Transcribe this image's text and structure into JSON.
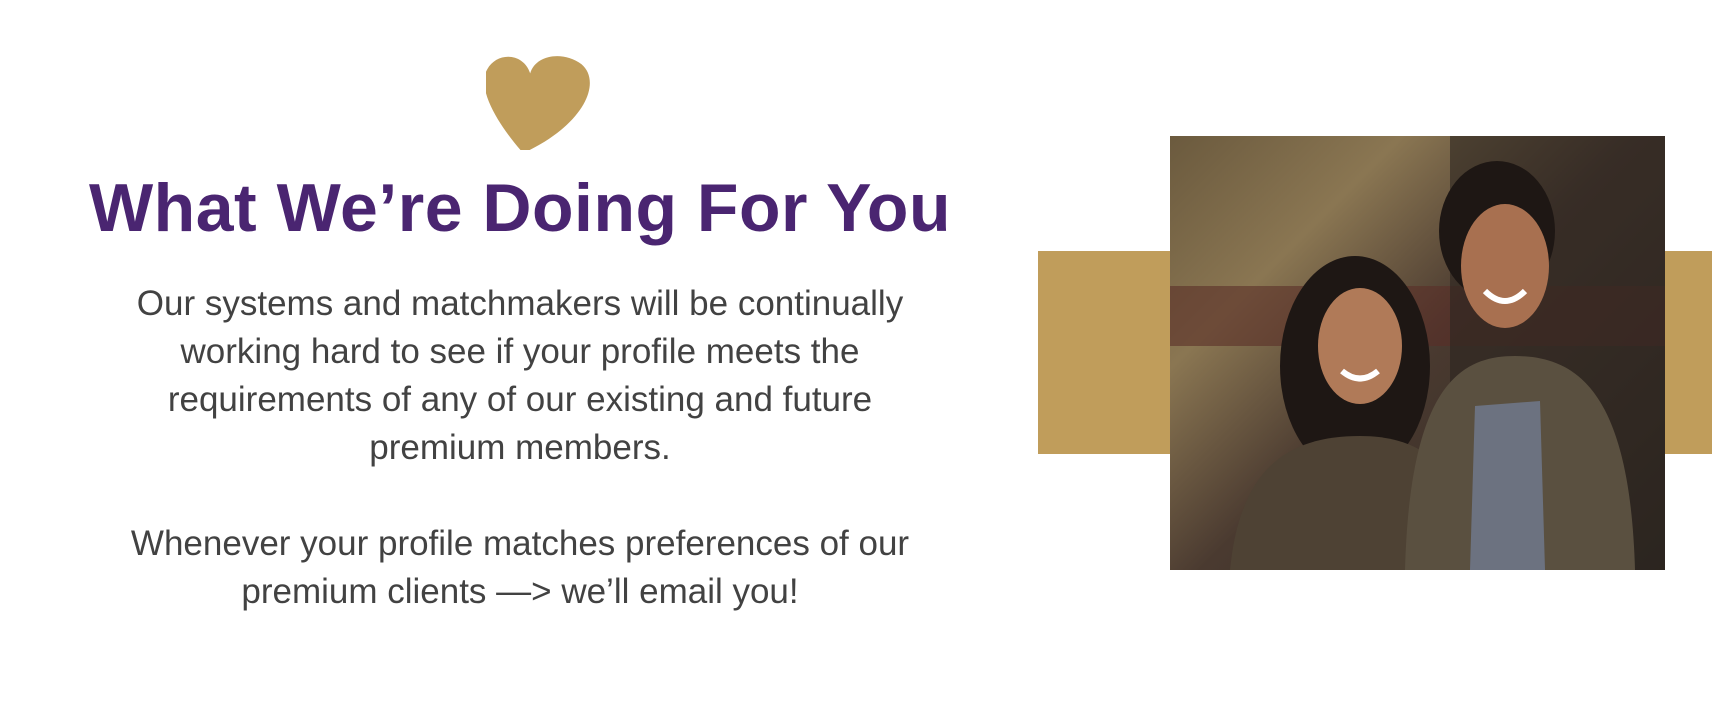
{
  "heading": "What We’re Doing For You",
  "paragraph1": [
    "Our systems and matchmakers will be continually",
    "working hard to see if your profile meets the",
    "requirements of any of our existing and future",
    "premium members."
  ],
  "paragraph2": [
    "Whenever your profile matches preferences of our",
    "premium clients —> we’ll email you!"
  ],
  "colors": {
    "accent": "#c09d5b",
    "heading": "#4a2571",
    "text": "#424242"
  },
  "icons": {
    "heart": "heart-icon"
  }
}
